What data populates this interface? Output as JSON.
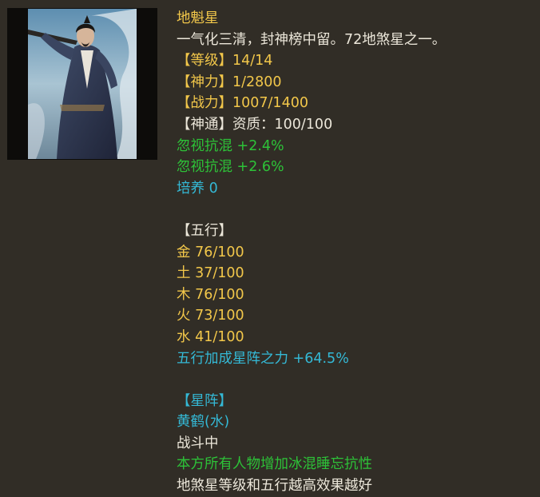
{
  "card": {
    "name": "地魁星",
    "description": "一气化三清，封神榜中留。72地煞星之一。",
    "stats": [
      {
        "label": "【等级】",
        "value": "14/14",
        "label_color": "#f2c74a",
        "value_color": "#f2c74a"
      },
      {
        "label": "【神力】",
        "value": "1/2800",
        "label_color": "#f2c74a",
        "value_color": "#f2c74a"
      },
      {
        "label": "【战力】",
        "value": "1007/1400",
        "label_color": "#f2c74a",
        "value_color": "#f2c74a"
      },
      {
        "label": "【神通】",
        "value": "资质：100/100",
        "label_color": "#ece7da",
        "value_color": "#ece7da"
      }
    ],
    "bonuses": [
      "忽视抗混 +2.4%",
      "忽视抗混 +2.6%"
    ],
    "cultivation": "培养 0",
    "five_elements": {
      "header": "【五行】",
      "items": [
        "金 76/100",
        "土 37/100",
        "木 76/100",
        "火 73/100",
        "水 41/100"
      ],
      "bonus": "五行加成星阵之力 +64.5%"
    },
    "formation": {
      "header": "【星阵】",
      "name": "黄鹤(水)",
      "status": "战斗中",
      "effect": "本方所有人物增加冰混睡忘抗性",
      "note": "地煞星等级和五行越高效果越好"
    }
  },
  "colors": {
    "background": "#312d26",
    "gold": "#f2c74a",
    "white": "#ece7da",
    "green": "#2dc238",
    "cyan": "#34b9d6"
  }
}
